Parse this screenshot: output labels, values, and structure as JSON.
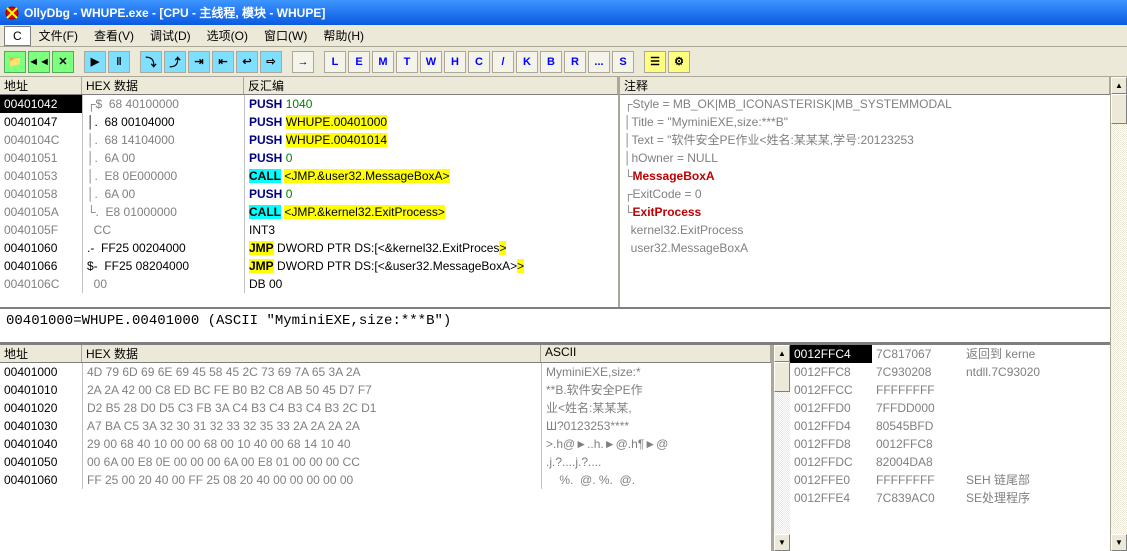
{
  "title": "OllyDbg - WHUPE.exe - [CPU - 主线程, 模块 - WHUPE]",
  "menu": {
    "c": "C",
    "file": "文件(F)",
    "view": "查看(V)",
    "debug": "调试(D)",
    "options": "选项(O)",
    "window": "窗口(W)",
    "help": "帮助(H)"
  },
  "cpuHeaders": {
    "addr": "地址",
    "hex": "HEX 数据",
    "asm": "反汇编",
    "cmt": "注释"
  },
  "disasm": [
    {
      "addr": "00401042",
      "sel": true,
      "sym": "┌$",
      "hex": "  68 40100000",
      "mn": "PUSH",
      "mnClass": "mn-push",
      "op": "1040",
      "opClass": "op-num"
    },
    {
      "addr": "00401047",
      "black": true,
      "sym": "│.",
      "hex": "  68 00104000",
      "mn": "PUSH",
      "mnClass": "mn-push",
      "op": "WHUPE.00401000",
      "opClass": "op-hi"
    },
    {
      "addr": "0040104C",
      "sym": "│.",
      "hex": "  68 14104000",
      "mn": "PUSH",
      "mnClass": "mn-push",
      "op": "WHUPE.00401014",
      "opClass": "op-hi"
    },
    {
      "addr": "00401051",
      "sym": "│.",
      "hex": "  6A 00",
      "mn": "PUSH",
      "mnClass": "mn-push",
      "op": "0",
      "opClass": "op-num"
    },
    {
      "addr": "00401053",
      "sym": "│.",
      "hex": "  E8 0E000000",
      "mn": "CALL",
      "mnClass": "mn-call",
      "op": "<JMP.&user32.MessageBoxA>",
      "opClass": "op-hi"
    },
    {
      "addr": "00401058",
      "sym": "│.",
      "hex": "  6A 00",
      "mn": "PUSH",
      "mnClass": "mn-push",
      "op": "0",
      "opClass": "op-num"
    },
    {
      "addr": "0040105A",
      "sym": "└.",
      "hex": "  E8 01000000",
      "mn": "CALL",
      "mnClass": "mn-call",
      "op": "<JMP.&kernel32.ExitProcess>",
      "opClass": "op-hi"
    },
    {
      "addr": "0040105F",
      "sym": "",
      "hex": "  CC",
      "mn": "INT3",
      "mnClass": "",
      "op": "",
      "opClass": ""
    },
    {
      "addr": "00401060",
      "sym": ".-",
      "hex": "  FF25 00204000",
      "black": true,
      "mn": "JMP",
      "mnClass": "mn-jmp",
      "op": "DWORD PTR DS:[<&kernel32.ExitProces",
      "opClass": "",
      "extra": ">"
    },
    {
      "addr": "00401066",
      "sym": "$-",
      "hex": "  FF25 08204000",
      "black": true,
      "mn": "JMP",
      "mnClass": "mn-jmp",
      "op": "DWORD PTR DS:[<&user32.MessageBoxA>",
      "opClass": "",
      "extra": ">"
    },
    {
      "addr": "0040106C",
      "sym": "",
      "hex": "  00",
      "mn": "DB 00",
      "mnClass": "",
      "op": "",
      "opClass": ""
    }
  ],
  "comments": [
    "┌Style = MB_OK|MB_ICONASTERISK|MB_SYSTEMMODAL",
    "│Title = \"MyminiEXE,size:***B\"",
    "│Text = \"软件安全PE作业<姓名:某某某,学号:20123253",
    "│hOwner = NULL",
    "└{RED}MessageBoxA",
    "┌ExitCode = 0",
    "└{RED}ExitProcess",
    "",
    "  kernel32.ExitProcess",
    "  user32.MessageBoxA",
    ""
  ],
  "statusLine": "00401000=WHUPE.00401000 (ASCII \"MyminiEXE,size:***B\")",
  "dumpHeaders": {
    "addr": "地址",
    "hex": "HEX 数据",
    "ascii": "ASCII"
  },
  "dump": [
    {
      "a": "00401000",
      "h": "4D 79 6D 69 6E 69 45 58 45 2C 73 69 7A 65 3A 2A",
      "asc": "MyminiEXE,size:*"
    },
    {
      "a": "00401010",
      "h": "2A 2A 42 00 C8 ED BC FE B0 B2 C8 AB 50 45 D7 F7",
      "asc": "**B.软件安全PE作"
    },
    {
      "a": "00401020",
      "h": "D2 B5 28 D0 D5 C3 FB 3A C4 B3 C4 B3 C4 B3 2C D1",
      "asc": "业<姓名:某某某,"
    },
    {
      "a": "00401030",
      "h": "A7 BA C5 3A 32 30 31 32 33 32 35 33 2A 2A 2A 2A",
      "asc": "Ш?0123253****"
    },
    {
      "a": "00401040",
      "h": "29 00 68 40 10 00 00 68 00 10 40 00 68 14 10 40",
      "asc": ">.h@►..h.►@.h¶►@"
    },
    {
      "a": "00401050",
      "h": "00 6A 00 E8 0E 00 00 00 6A 00 E8 01 00 00 00 CC",
      "asc": ".j.?....j.?...."
    },
    {
      "a": "00401060",
      "h": "FF 25 00 20 40 00 FF 25 08 20 40 00 00 00 00 00",
      "asc": "    %.  @. %.  @."
    }
  ],
  "stack": [
    {
      "a": "0012FFC4",
      "sel": true,
      "v": "7C817067",
      "c": "返回到 kerne"
    },
    {
      "a": "0012FFC8",
      "v": "7C930208",
      "c": "ntdll.7C93020"
    },
    {
      "a": "0012FFCC",
      "v": "FFFFFFFF",
      "c": ""
    },
    {
      "a": "0012FFD0",
      "v": "7FFDD000",
      "c": ""
    },
    {
      "a": "0012FFD4",
      "v": "80545BFD",
      "c": ""
    },
    {
      "a": "0012FFD8",
      "v": "0012FFC8",
      "c": ""
    },
    {
      "a": "0012FFDC",
      "v": "82004DA8",
      "c": ""
    },
    {
      "a": "0012FFE0",
      "v": "FFFFFFFF",
      "c": "SEH 链尾部"
    },
    {
      "a": "0012FFE4",
      "v": "7C839AC0",
      "c": "SE处理程序"
    }
  ],
  "winBtns": [
    "L",
    "E",
    "M",
    "T",
    "W",
    "H",
    "C",
    "/",
    "K",
    "B",
    "R",
    "...",
    "S"
  ]
}
